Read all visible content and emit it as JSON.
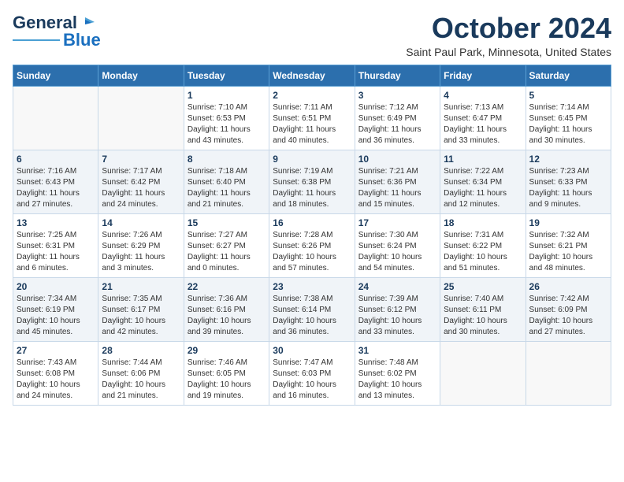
{
  "logo": {
    "line1": "General",
    "line2": "Blue"
  },
  "title": "October 2024",
  "location": "Saint Paul Park, Minnesota, United States",
  "days_of_week": [
    "Sunday",
    "Monday",
    "Tuesday",
    "Wednesday",
    "Thursday",
    "Friday",
    "Saturday"
  ],
  "weeks": [
    [
      {
        "day": "",
        "info": ""
      },
      {
        "day": "",
        "info": ""
      },
      {
        "day": "1",
        "info": "Sunrise: 7:10 AM\nSunset: 6:53 PM\nDaylight: 11 hours\nand 43 minutes."
      },
      {
        "day": "2",
        "info": "Sunrise: 7:11 AM\nSunset: 6:51 PM\nDaylight: 11 hours\nand 40 minutes."
      },
      {
        "day": "3",
        "info": "Sunrise: 7:12 AM\nSunset: 6:49 PM\nDaylight: 11 hours\nand 36 minutes."
      },
      {
        "day": "4",
        "info": "Sunrise: 7:13 AM\nSunset: 6:47 PM\nDaylight: 11 hours\nand 33 minutes."
      },
      {
        "day": "5",
        "info": "Sunrise: 7:14 AM\nSunset: 6:45 PM\nDaylight: 11 hours\nand 30 minutes."
      }
    ],
    [
      {
        "day": "6",
        "info": "Sunrise: 7:16 AM\nSunset: 6:43 PM\nDaylight: 11 hours\nand 27 minutes."
      },
      {
        "day": "7",
        "info": "Sunrise: 7:17 AM\nSunset: 6:42 PM\nDaylight: 11 hours\nand 24 minutes."
      },
      {
        "day": "8",
        "info": "Sunrise: 7:18 AM\nSunset: 6:40 PM\nDaylight: 11 hours\nand 21 minutes."
      },
      {
        "day": "9",
        "info": "Sunrise: 7:19 AM\nSunset: 6:38 PM\nDaylight: 11 hours\nand 18 minutes."
      },
      {
        "day": "10",
        "info": "Sunrise: 7:21 AM\nSunset: 6:36 PM\nDaylight: 11 hours\nand 15 minutes."
      },
      {
        "day": "11",
        "info": "Sunrise: 7:22 AM\nSunset: 6:34 PM\nDaylight: 11 hours\nand 12 minutes."
      },
      {
        "day": "12",
        "info": "Sunrise: 7:23 AM\nSunset: 6:33 PM\nDaylight: 11 hours\nand 9 minutes."
      }
    ],
    [
      {
        "day": "13",
        "info": "Sunrise: 7:25 AM\nSunset: 6:31 PM\nDaylight: 11 hours\nand 6 minutes."
      },
      {
        "day": "14",
        "info": "Sunrise: 7:26 AM\nSunset: 6:29 PM\nDaylight: 11 hours\nand 3 minutes."
      },
      {
        "day": "15",
        "info": "Sunrise: 7:27 AM\nSunset: 6:27 PM\nDaylight: 11 hours\nand 0 minutes."
      },
      {
        "day": "16",
        "info": "Sunrise: 7:28 AM\nSunset: 6:26 PM\nDaylight: 10 hours\nand 57 minutes."
      },
      {
        "day": "17",
        "info": "Sunrise: 7:30 AM\nSunset: 6:24 PM\nDaylight: 10 hours\nand 54 minutes."
      },
      {
        "day": "18",
        "info": "Sunrise: 7:31 AM\nSunset: 6:22 PM\nDaylight: 10 hours\nand 51 minutes."
      },
      {
        "day": "19",
        "info": "Sunrise: 7:32 AM\nSunset: 6:21 PM\nDaylight: 10 hours\nand 48 minutes."
      }
    ],
    [
      {
        "day": "20",
        "info": "Sunrise: 7:34 AM\nSunset: 6:19 PM\nDaylight: 10 hours\nand 45 minutes."
      },
      {
        "day": "21",
        "info": "Sunrise: 7:35 AM\nSunset: 6:17 PM\nDaylight: 10 hours\nand 42 minutes."
      },
      {
        "day": "22",
        "info": "Sunrise: 7:36 AM\nSunset: 6:16 PM\nDaylight: 10 hours\nand 39 minutes."
      },
      {
        "day": "23",
        "info": "Sunrise: 7:38 AM\nSunset: 6:14 PM\nDaylight: 10 hours\nand 36 minutes."
      },
      {
        "day": "24",
        "info": "Sunrise: 7:39 AM\nSunset: 6:12 PM\nDaylight: 10 hours\nand 33 minutes."
      },
      {
        "day": "25",
        "info": "Sunrise: 7:40 AM\nSunset: 6:11 PM\nDaylight: 10 hours\nand 30 minutes."
      },
      {
        "day": "26",
        "info": "Sunrise: 7:42 AM\nSunset: 6:09 PM\nDaylight: 10 hours\nand 27 minutes."
      }
    ],
    [
      {
        "day": "27",
        "info": "Sunrise: 7:43 AM\nSunset: 6:08 PM\nDaylight: 10 hours\nand 24 minutes."
      },
      {
        "day": "28",
        "info": "Sunrise: 7:44 AM\nSunset: 6:06 PM\nDaylight: 10 hours\nand 21 minutes."
      },
      {
        "day": "29",
        "info": "Sunrise: 7:46 AM\nSunset: 6:05 PM\nDaylight: 10 hours\nand 19 minutes."
      },
      {
        "day": "30",
        "info": "Sunrise: 7:47 AM\nSunset: 6:03 PM\nDaylight: 10 hours\nand 16 minutes."
      },
      {
        "day": "31",
        "info": "Sunrise: 7:48 AM\nSunset: 6:02 PM\nDaylight: 10 hours\nand 13 minutes."
      },
      {
        "day": "",
        "info": ""
      },
      {
        "day": "",
        "info": ""
      }
    ]
  ]
}
